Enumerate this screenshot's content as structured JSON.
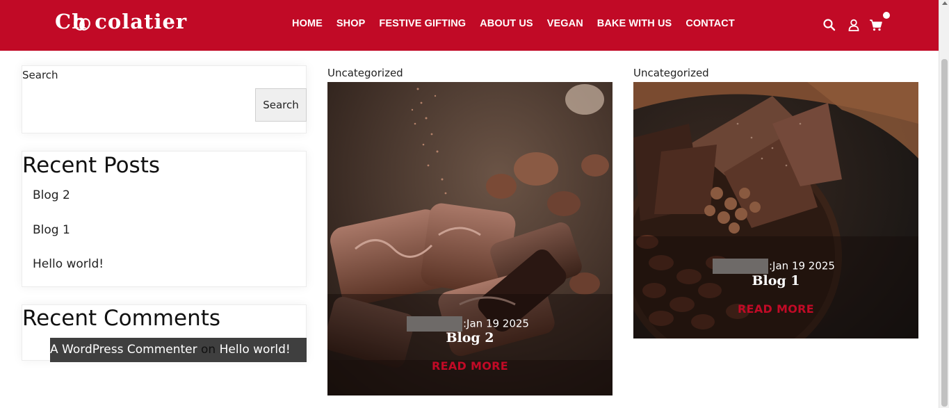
{
  "header": {
    "logo": "Ch colatier",
    "nav": [
      "HOME",
      "SHOP",
      "FESTIVE GIFTING",
      "ABOUT US",
      "VEGAN",
      "BAKE WITH US",
      "CONTACT"
    ],
    "accent_color": "#c10a26",
    "icons": [
      "search-icon",
      "user-icon",
      "cart-icon"
    ]
  },
  "sidebar": {
    "search": {
      "label": "Search",
      "button": "Search",
      "value": ""
    },
    "recent_posts": {
      "title": "Recent Posts",
      "items": [
        "Blog 2",
        "Blog 1",
        "Hello world!"
      ]
    },
    "recent_comments": {
      "title": "Recent Comments",
      "author": "A WordPress Commenter",
      "on": "on",
      "post": "Hello world!"
    }
  },
  "posts": [
    {
      "category": "Uncategorized",
      "date": ":Jan  19  2025",
      "title": "Blog 2",
      "read_more": "READ MORE"
    },
    {
      "category": "Uncategorized",
      "date": ":Jan  19  2025",
      "title": "Blog 1",
      "read_more": "READ MORE"
    }
  ]
}
